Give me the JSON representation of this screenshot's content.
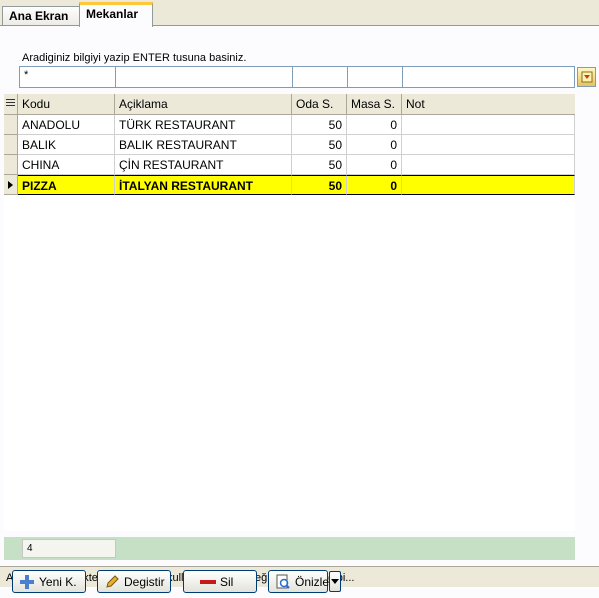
{
  "tabs": [
    {
      "label": "Ana Ekran"
    },
    {
      "label": "Mekanlar"
    }
  ],
  "search": {
    "hint": "Aradiginiz bilgiyi yazip ENTER tusuna basiniz.",
    "filter_value": "*"
  },
  "grid": {
    "columns": [
      "Kodu",
      "Açiklama",
      "Oda S.",
      "Masa S.",
      "Not"
    ],
    "rows": [
      {
        "kodu": "ANADOLU",
        "aciklama": "TÜRK RESTAURANT",
        "oda": "50",
        "masa": "0",
        "not": ""
      },
      {
        "kodu": "BALIK",
        "aciklama": "BALIK RESTAURANT",
        "oda": "50",
        "masa": "0",
        "not": ""
      },
      {
        "kodu": "CHINA",
        "aciklama": "ÇİN RESTAURANT",
        "oda": "50",
        "masa": "0",
        "not": ""
      },
      {
        "kodu": "PIZZA",
        "aciklama": "İTALYAN RESTAURANT",
        "oda": "50",
        "masa": "0",
        "not": ""
      }
    ],
    "selected_index": 3,
    "record_count": "4"
  },
  "status": {
    "text": "ALT tuşu ile birlikte altı çizili harfi kullanabilirsiniz. Değiştir (ALT-D) gibi..."
  },
  "toolbar": {
    "new_label": "Yeni K.",
    "edit_label": "Degistir",
    "delete_label": "Sil",
    "preview_label": "Önizle"
  },
  "colors": {
    "selection": "#ffff00",
    "footer": "#c6e0c6",
    "tab_accent": "#ffc83c"
  }
}
